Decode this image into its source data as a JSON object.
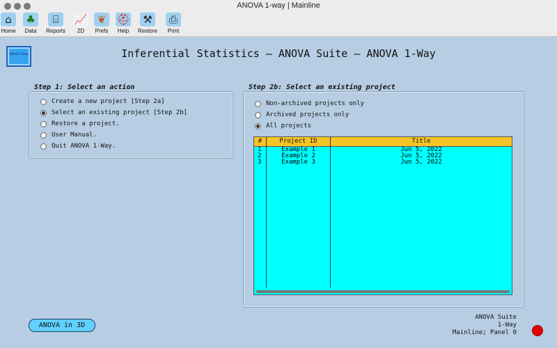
{
  "window": {
    "title": "ANOVA 1-way | Mainline"
  },
  "toolbar": {
    "items": [
      {
        "label": "Home",
        "icon": "home-icon"
      },
      {
        "label": "Data",
        "icon": "tree-icon"
      },
      {
        "label": "Reports",
        "icon": "building-icon"
      },
      {
        "label": "2D",
        "icon": "chart-icon"
      },
      {
        "label": "Prefs",
        "icon": "leaf-icon"
      },
      {
        "label": "Help",
        "icon": "helmet-icon"
      },
      {
        "label": "Restore",
        "icon": "tools-icon"
      },
      {
        "label": "Print",
        "icon": "printer-icon"
      }
    ]
  },
  "logo": {
    "text": "ANOVA 1-Way"
  },
  "page": {
    "title": "Inferential Statistics — ANOVA Suite — ANOVA 1-Way"
  },
  "step1": {
    "title": "Step 1: Select an action",
    "options": [
      {
        "label": "Create a new project [Step 2a]",
        "selected": false
      },
      {
        "label": "Select an existing project [Step 2b]",
        "selected": true
      },
      {
        "label": "Restore a project.",
        "selected": false
      },
      {
        "label": "User Manual.",
        "selected": false
      },
      {
        "label": "Quit ANOVA 1-Way.",
        "selected": false
      }
    ]
  },
  "step2b": {
    "title": "Step 2b: Select an existing project",
    "filters": [
      {
        "label": "Non-archived projects only",
        "selected": false
      },
      {
        "label": "Archived projects only",
        "selected": false
      },
      {
        "label": "All projects",
        "selected": true
      }
    ],
    "table": {
      "headers": [
        "#",
        "Project ID",
        "Title"
      ],
      "rows": [
        [
          "1",
          "Example 1",
          "Jun 5, 2022"
        ],
        [
          "2",
          "Example 2",
          "Jun 5, 2022"
        ],
        [
          "3",
          "Example 3",
          "Jun 5, 2022"
        ]
      ]
    }
  },
  "buttons": {
    "anova3d": "ANOVA in 3D"
  },
  "footer": {
    "line1": "ANOVA Suite",
    "line2": "1-Way",
    "line3": "Mainline; Panel 0"
  },
  "colors": {
    "background": "#b6cde3",
    "table_bg": "#00ffff",
    "table_header": "#f5c425",
    "button": "#5fd0ff",
    "led": "#e40000"
  }
}
